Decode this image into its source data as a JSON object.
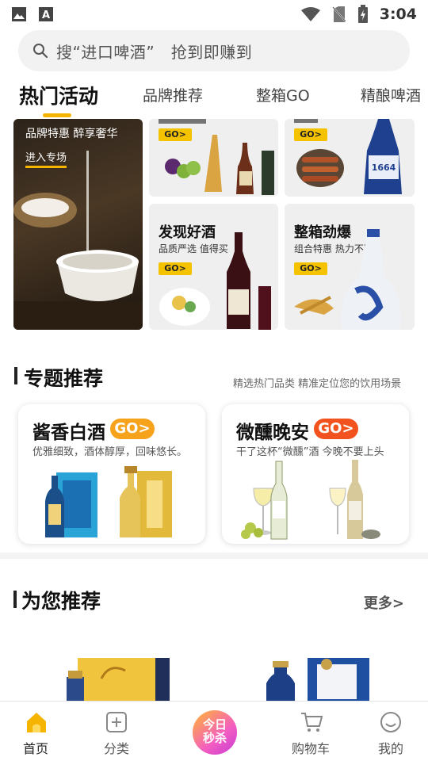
{
  "status_bar": {
    "time": "3:04"
  },
  "search": {
    "placeholder": "搜“进口啤酒”   抢到即赚到"
  },
  "tabs": [
    {
      "label": "热门活动",
      "active": true
    },
    {
      "label": "品牌推荐",
      "active": false
    },
    {
      "label": "整箱GO",
      "active": false
    },
    {
      "label": "精酿啤酒",
      "active": false
    }
  ],
  "banners": {
    "big": {
      "title": "品牌特惠 醉享奢华",
      "link": "进入专场"
    },
    "cards": [
      {
        "title": "",
        "sub": "",
        "go": "GO>"
      },
      {
        "title": "",
        "sub": "",
        "go": "GO>"
      },
      {
        "title": "发现好酒",
        "sub": "品质严选 值得买",
        "go": "GO>"
      },
      {
        "title": "整箱劲爆",
        "sub": "组合特惠 热力不减",
        "go": "GO>"
      }
    ]
  },
  "topics_section": {
    "title": "专题推荐",
    "note": "精选热门品类 精准定位您的饮用场景",
    "cards": [
      {
        "name": "酱香白酒",
        "go": "GO>",
        "desc": "优雅细致，酒体醇厚，回味悠长。"
      },
      {
        "name": "微醺晚安",
        "go": "GO>",
        "desc": "干了这杯“微醺”酒 今晚不要上头"
      }
    ]
  },
  "recommend_section": {
    "title": "为您推荐",
    "more": "更多>"
  },
  "bottom_nav": {
    "items": [
      {
        "label": "首页",
        "icon": "home-icon",
        "active": true
      },
      {
        "label": "分类",
        "icon": "category-icon",
        "active": false
      },
      {
        "label": "购物车",
        "icon": "cart-icon",
        "active": false
      },
      {
        "label": "我的",
        "icon": "profile-icon",
        "active": false
      }
    ],
    "flash_sale": {
      "line1": "今日",
      "line2": "秒杀"
    }
  },
  "colors": {
    "accent": "#f5b400",
    "go_orange": "#f6a21a",
    "go_red": "#f2531e"
  }
}
